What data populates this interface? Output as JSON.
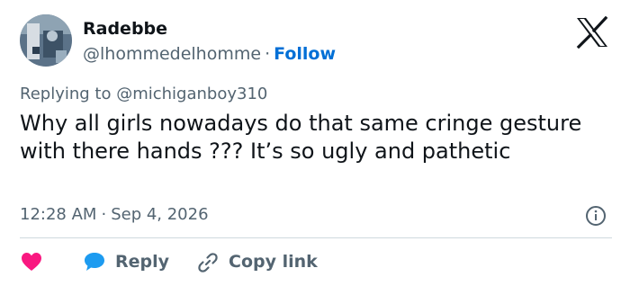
{
  "header": {
    "display_name": "Radebbe",
    "handle": "@lhommedelhomme",
    "separator": "·",
    "follow_label": "Follow",
    "logo_icon": "x-logo-icon"
  },
  "reply_context": {
    "prefix": "Replying to",
    "mention": "@michiganboy310"
  },
  "tweet": {
    "text": "Why all girls nowadays do that same cringe gesture with there hands ??? It’s so ugly and pathetic"
  },
  "meta": {
    "time": "12:28 AM",
    "separator": "·",
    "date": "Sep 4, 2026",
    "info_icon": "info-icon"
  },
  "actions": {
    "like_icon": "heart-icon",
    "reply_icon": "speech-bubble-icon",
    "reply_label": "Reply",
    "copy_icon": "link-icon",
    "copy_label": "Copy link"
  },
  "colors": {
    "heart": "#f91880",
    "reply_bubble": "#1d9bf0",
    "follow": "#006fd6",
    "secondary_text": "#536471",
    "primary_text": "#0f1419"
  }
}
